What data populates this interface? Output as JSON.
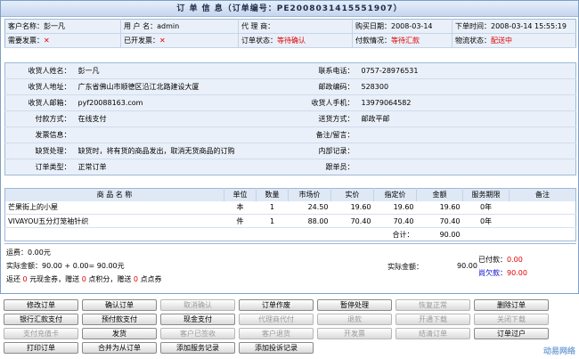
{
  "title": "订 单 信 息（订单编号：PE2008031415551907）",
  "summary": {
    "customer_label": "客户名称：",
    "customer": "彭一凡",
    "username_label": "用 户 名：",
    "username": "admin",
    "agent_label": "代 理 商：",
    "agent": "",
    "purchase_date_label": "购买日期：",
    "purchase_date": "2008-03-14",
    "order_time_label": "下单时间：",
    "order_time": "2008-03-14 15:55:19",
    "need_invoice_label": "需要发票：",
    "need_invoice": "✕",
    "invoiced_label": "已开发票：",
    "invoiced": "✕",
    "order_status_label": "订单状态：",
    "order_status": "等待确认",
    "pay_status_label": "付款情况：",
    "pay_status": "等待汇款",
    "logistics_label": "物流状态：",
    "logistics": "配送中"
  },
  "info": {
    "receiver_name_label": "收货人姓名：",
    "receiver_name": "彭一凡",
    "phone_label": "联系电话：",
    "phone": "0757-28976531",
    "address_label": "收货人地址：",
    "address": "广东省佛山市顺德区沿江北路建设大厦",
    "zip_label": "邮政编码：",
    "zip": "528300",
    "email_label": "收货人邮箱：",
    "email": "pyf20088163.com",
    "mobile_label": "收货人手机：",
    "mobile": "13979064582",
    "pay_method_label": "付款方式：",
    "pay_method": "在线支付",
    "ship_method_label": "送货方式：",
    "ship_method": "邮政平邮",
    "invoice_info_label": "发票信息：",
    "invoice_info": "",
    "remark_label": "备注/留言：",
    "remark": "",
    "shortage_label": "缺货处理：",
    "shortage": "缺货时，将有货的商品发出，取消无货商品的订购",
    "internal_label": "内部记录：",
    "internal": "",
    "order_type_label": "订单类型：",
    "order_type": "正常订单",
    "follower_label": "跟单员：",
    "follower": ""
  },
  "items": {
    "headers": [
      "商 品 名 称",
      "单位",
      "数量",
      "市场价",
      "实价",
      "指定价",
      "金额",
      "服务期限",
      "备注"
    ],
    "rows": [
      {
        "name": "芒果街上的小屋",
        "unit": "本",
        "qty": "1",
        "market": "24.50",
        "real": "19.60",
        "set": "19.60",
        "amount": "19.60",
        "service": "0年",
        "note": ""
      },
      {
        "name": "VIVAYOU五分灯笼袖针织",
        "unit": "件",
        "qty": "1",
        "market": "88.00",
        "real": "70.40",
        "set": "70.40",
        "amount": "70.40",
        "service": "0年",
        "note": ""
      }
    ],
    "total_label": "合计：",
    "total": "90.00"
  },
  "totals": {
    "freight_label": "运费：",
    "freight": "0.00元",
    "actual_line": "实际金额：90.00 + 0.00= 90.00元",
    "rebate_prefix": "返还",
    "rebate_cash": "0",
    "rebate_cash_unit": "元现金券，赠送",
    "rebate_points": "0",
    "rebate_points_unit": "点积分，赠送",
    "rebate_coupons": "0",
    "rebate_coupons_unit": "点点券",
    "actual_label": "实际金额：",
    "actual": "90.00",
    "paid_label": "已付款：",
    "paid": "0.00",
    "owed_label": "尚欠款：",
    "owed": "90.00"
  },
  "buttons": [
    {
      "label": "修改订单",
      "enabled": true
    },
    {
      "label": "确认订单",
      "enabled": true
    },
    {
      "label": "取消确认",
      "enabled": false
    },
    {
      "label": "订单作废",
      "enabled": true
    },
    {
      "label": "暂停处理",
      "enabled": true
    },
    {
      "label": "恢复正常",
      "enabled": false
    },
    {
      "label": "删除订单",
      "enabled": true
    },
    {
      "label": "银行汇款支付",
      "enabled": true
    },
    {
      "label": "预付款支付",
      "enabled": true
    },
    {
      "label": "现金支付",
      "enabled": true
    },
    {
      "label": "代理商代付",
      "enabled": false
    },
    {
      "label": "退款",
      "enabled": false
    },
    {
      "label": "开通下载",
      "enabled": false
    },
    {
      "label": "关闭下载",
      "enabled": false
    },
    {
      "label": "支付充值卡",
      "enabled": false
    },
    {
      "label": "发货",
      "enabled": true
    },
    {
      "label": "客户已签收",
      "enabled": false
    },
    {
      "label": "客户退货",
      "enabled": false
    },
    {
      "label": "开发票",
      "enabled": false
    },
    {
      "label": "结清订单",
      "enabled": false
    },
    {
      "label": "订单过户",
      "enabled": true
    },
    {
      "label": "打印订单",
      "enabled": true
    },
    {
      "label": "合并为从订单",
      "enabled": true
    },
    {
      "label": "添加服务记录",
      "enabled": true
    },
    {
      "label": "添加投诉记录",
      "enabled": true
    }
  ],
  "watermark": "动易网络"
}
